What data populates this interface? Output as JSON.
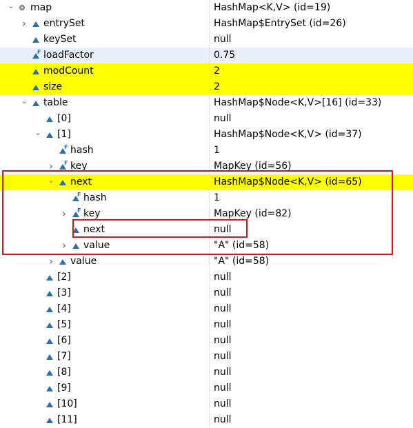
{
  "variables": [
    {
      "name": "map",
      "value": "HashMap<K,V>  (id=19)",
      "indent": 0,
      "twisty": "expanded",
      "icon": "object"
    },
    {
      "name": "entrySet",
      "value": "HashMap$EntrySet  (id=26)",
      "indent": 1,
      "twisty": "collapsed",
      "icon": "field"
    },
    {
      "name": "keySet",
      "value": "null",
      "indent": 1,
      "twisty": "none",
      "icon": "field"
    },
    {
      "name": "loadFactor",
      "value": "0.75",
      "indent": 1,
      "twisty": "none",
      "icon": "field-final",
      "highlight": "hover"
    },
    {
      "name": "modCount",
      "value": "2",
      "indent": 1,
      "twisty": "none",
      "icon": "field",
      "highlight": "changed"
    },
    {
      "name": "size",
      "value": "2",
      "indent": 1,
      "twisty": "none",
      "icon": "field",
      "highlight": "changed"
    },
    {
      "name": "table",
      "value": "HashMap$Node<K,V>[16]  (id=33)",
      "indent": 1,
      "twisty": "expanded",
      "icon": "field"
    },
    {
      "name": "[0]",
      "value": "null",
      "indent": 2,
      "twisty": "none",
      "icon": "field"
    },
    {
      "name": "[1]",
      "value": "HashMap$Node<K,V>  (id=37)",
      "indent": 2,
      "twisty": "expanded",
      "icon": "field"
    },
    {
      "name": "hash",
      "value": "1",
      "indent": 3,
      "twisty": "none",
      "icon": "field-final"
    },
    {
      "name": "key",
      "value": "MapKey  (id=56)",
      "indent": 3,
      "twisty": "collapsed",
      "icon": "field-final"
    },
    {
      "name": "next",
      "value": "HashMap$Node<K,V>  (id=65)",
      "indent": 3,
      "twisty": "expanded",
      "icon": "field",
      "highlight": "changed"
    },
    {
      "name": "hash",
      "value": "1",
      "indent": 4,
      "twisty": "none",
      "icon": "field-final"
    },
    {
      "name": "key",
      "value": "MapKey  (id=82)",
      "indent": 4,
      "twisty": "collapsed",
      "icon": "field-final"
    },
    {
      "name": "next",
      "value": "null",
      "indent": 4,
      "twisty": "none",
      "icon": "field"
    },
    {
      "name": "value",
      "value": "\"A\" (id=58)",
      "indent": 4,
      "twisty": "collapsed",
      "icon": "field"
    },
    {
      "name": "value",
      "value": "\"A\" (id=58)",
      "indent": 3,
      "twisty": "collapsed",
      "icon": "field"
    },
    {
      "name": "[2]",
      "value": "null",
      "indent": 2,
      "twisty": "none",
      "icon": "field"
    },
    {
      "name": "[3]",
      "value": "null",
      "indent": 2,
      "twisty": "none",
      "icon": "field"
    },
    {
      "name": "[4]",
      "value": "null",
      "indent": 2,
      "twisty": "none",
      "icon": "field"
    },
    {
      "name": "[5]",
      "value": "null",
      "indent": 2,
      "twisty": "none",
      "icon": "field"
    },
    {
      "name": "[6]",
      "value": "null",
      "indent": 2,
      "twisty": "none",
      "icon": "field"
    },
    {
      "name": "[7]",
      "value": "null",
      "indent": 2,
      "twisty": "none",
      "icon": "field"
    },
    {
      "name": "[8]",
      "value": "null",
      "indent": 2,
      "twisty": "none",
      "icon": "field"
    },
    {
      "name": "[9]",
      "value": "null",
      "indent": 2,
      "twisty": "none",
      "icon": "field"
    },
    {
      "name": "[10]",
      "value": "null",
      "indent": 2,
      "twisty": "none",
      "icon": "field"
    },
    {
      "name": "[11]",
      "value": "null",
      "indent": 2,
      "twisty": "none",
      "icon": "field"
    }
  ],
  "colors": {
    "changed_highlight": "#ffff00",
    "hover_highlight": "#e8f1fb",
    "annotation_border": "#d9141c",
    "field_icon": "#2a6fb0"
  }
}
